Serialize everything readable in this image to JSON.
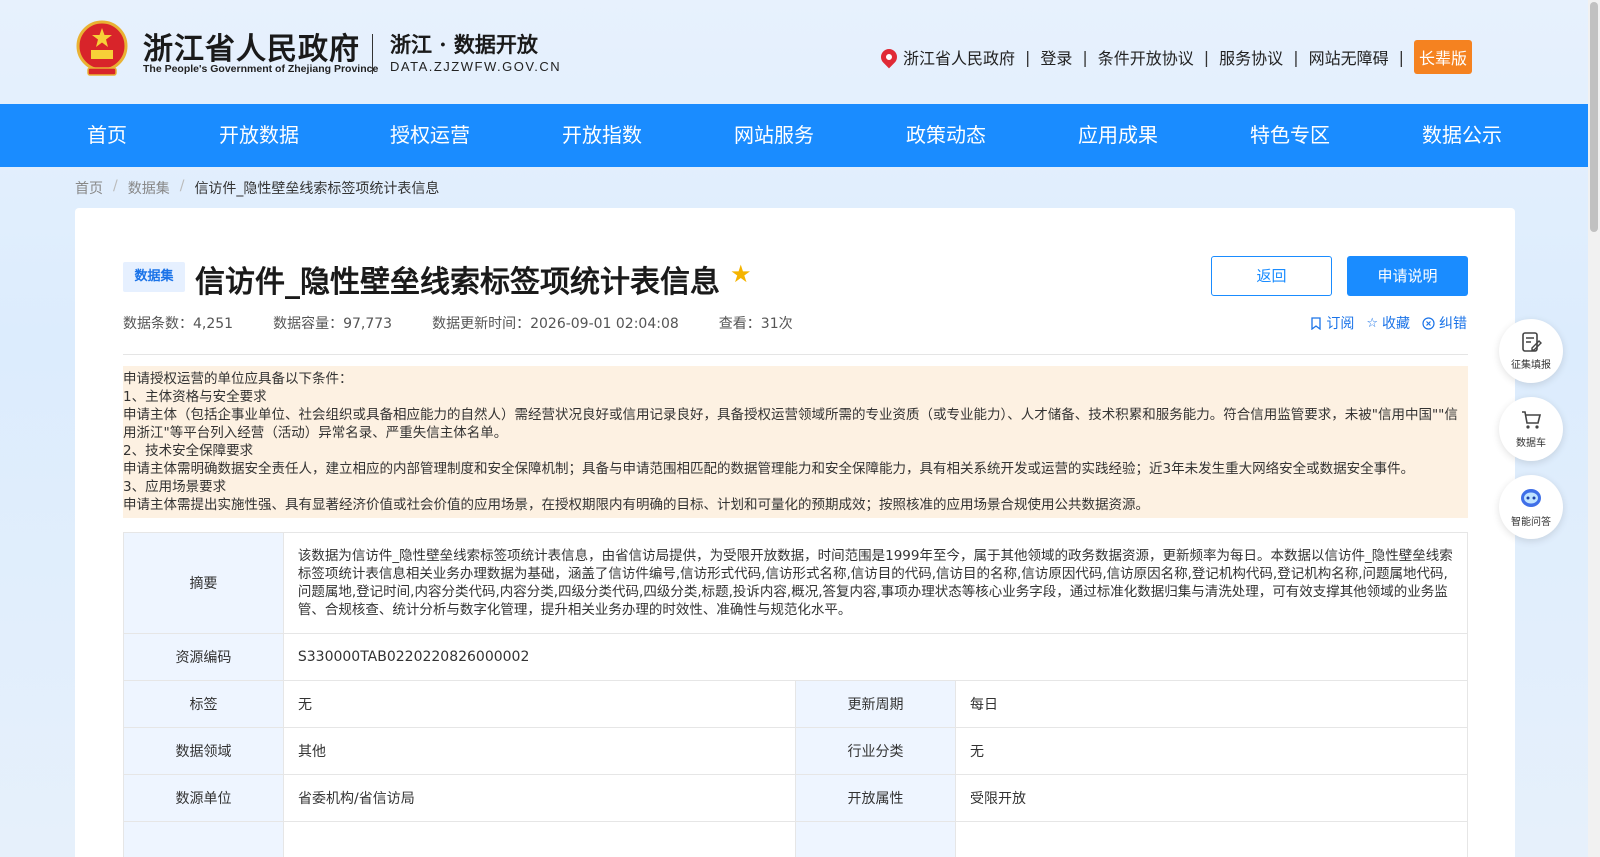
{
  "header": {
    "gov_title": "浙江省人民政府",
    "gov_subtitle": "The People's Government of Zhejiang Province",
    "site_title": "浙江 · 数据开放",
    "site_url": "DATA.ZJZWFW.GOV.CN",
    "links": {
      "province": "浙江省人民政府",
      "login": "登录",
      "conditional_agreement": "条件开放协议",
      "service_agreement": "服务协议",
      "accessibility": "网站无障碍",
      "elder_mode": "长辈版"
    }
  },
  "nav": [
    "首页",
    "开放数据",
    "授权运营",
    "开放指数",
    "网站服务",
    "政策动态",
    "应用成果",
    "特色专区",
    "数据公示"
  ],
  "breadcrumb": {
    "home": "首页",
    "datasets": "数据集",
    "current": "信访件_隐性壁垒线索标签项统计表信息"
  },
  "dataset": {
    "badge": "数据集",
    "title": "信访件_隐性壁垒线索标签项统计表信息",
    "back_label": "返回",
    "apply_label": "申请说明",
    "meta": {
      "record_count": "数据条数：4,251",
      "data_size": "数据容量：97,773",
      "updated": "数据更新时间：2026-09-01 02:04:08",
      "views": "查看：31次"
    },
    "actions": {
      "subscribe": "订阅",
      "favorite": "收藏",
      "correct": "纠错"
    }
  },
  "notice": [
    "申请授权运营的单位应具备以下条件：",
    "1、主体资格与安全要求",
    "申请主体（包括企事业单位、社会组织或具备相应能力的自然人）需经营状况良好或信用记录良好，具备授权运营领域所需的专业资质（或专业能力）、人才储备、技术积累和服务能力。符合信用监管要求，未被\"信用中国\"\"信用浙江\"等平台列入经营（活动）异常名录、严重失信主体名单。",
    "2、技术安全保障要求",
    "申请主体需明确数据安全责任人，建立相应的内部管理制度和安全保障机制；具备与申请范围相匹配的数据管理能力和安全保障能力，具有相关系统开发或运营的实践经验；近3年未发生重大网络安全或数据安全事件。",
    "3、应用场景要求",
    "申请主体需提出实施性强、具有显著经济价值或社会价值的应用场景，在授权期限内有明确的目标、计划和可量化的预期成效；按照核准的应用场景合规使用公共数据资源。"
  ],
  "info": {
    "abstract_label": "摘要",
    "abstract": "该数据为信访件_隐性壁垒线索标签项统计表信息，由省信访局提供，为受限开放数据，时间范围是1999年至今，属于其他领域的政务数据资源，更新频率为每日。本数据以信访件_隐性壁垒线索标签项统计表信息相关业务办理数据为基础，涵盖了信访件编号,信访形式代码,信访形式名称,信访目的代码,信访目的名称,信访原因代码,信访原因名称,登记机构代码,登记机构名称,问题属地代码,问题属地,登记时间,内容分类代码,内容分类,四级分类代码,四级分类,标题,投诉内容,概况,答复内容,事项办理状态等核心业务字段，通过标准化数据归集与清洗处理，可有效支撑其他领域的业务监管、合规核查、统计分析与数字化管理，提升相关业务办理的时效性、准确性与规范化水平。",
    "code_label": "资源编码",
    "code": "S330000TAB0220220826000002",
    "tags_label": "标签",
    "tags": "无",
    "cycle_label": "更新周期",
    "cycle": "每日",
    "domain_label": "数据领域",
    "domain": "其他",
    "industry_label": "行业分类",
    "industry": "无",
    "unit_label": "数源单位",
    "unit": "省委机构/省信访局",
    "open_label": "开放属性",
    "open": "受限开放"
  },
  "float": {
    "survey": "征集填报",
    "cart": "数据车",
    "qa": "智能问答"
  },
  "colors": {
    "primary": "#1a8cff",
    "accent": "#f58220",
    "notice_bg": "#fdf1e2"
  }
}
